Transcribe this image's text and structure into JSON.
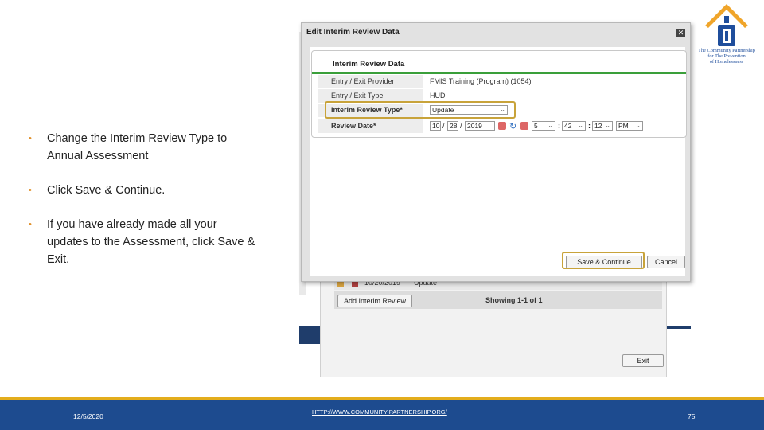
{
  "logo": {
    "lines": [
      "The Community Partnership",
      "for The Prevention",
      "of Homelessness"
    ]
  },
  "bullets": [
    "Change the Interim Review Type to Annual Assessment",
    "Click Save & Continue.",
    "If you have already made all your updates to the Assessment, click Save & Exit."
  ],
  "background_page": {
    "row_date": "10/20/2019",
    "row_type": "Update",
    "add_button": "Add Interim Review",
    "showing": "Showing 1-1 of 1",
    "exit_button": "Exit"
  },
  "modal": {
    "title": "Edit Interim Review Data",
    "panel_title": "Interim Review Data",
    "fields": [
      {
        "label": "Entry / Exit Provider",
        "value": "FMIS Training (Program) (1054)"
      },
      {
        "label": "Entry / Exit Type",
        "value": "HUD"
      },
      {
        "label": "Interim Review Type*",
        "value": "Update"
      },
      {
        "label": "Review Date*"
      }
    ],
    "review_date": {
      "month": "10",
      "day": "28",
      "year": "2019",
      "hour": "5",
      "minute": "42",
      "second": "12",
      "ampm": "PM"
    },
    "save_button": "Save & Continue",
    "cancel_button": "Cancel"
  },
  "footer": {
    "date": "12/5/2020",
    "url": "HTTP://WWW.COMMUNITY-PARTNERSHIP.ORG/",
    "page": "75"
  },
  "colors": {
    "footer_blue": "#1d4b8f",
    "footer_gold": "#e3ad1d",
    "highlight": "#c8a33a",
    "bullet": "#e0902a",
    "panel_green": "#3a9f3a"
  }
}
